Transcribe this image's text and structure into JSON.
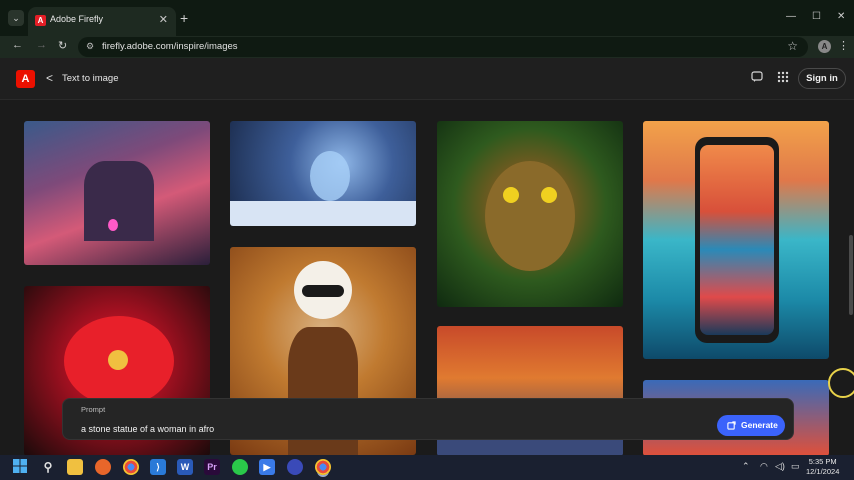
{
  "browser": {
    "tab_title": "Adobe Firefly",
    "url": "firefly.adobe.com/inspire/images",
    "tab_menu_icon": "chevron-down-icon",
    "new_tab_symbol": "+",
    "close_tab_symbol": "✕",
    "minimize_symbol": "—",
    "maximize_symbol": "☐",
    "close_window_symbol": "✕",
    "profile_initial": "A"
  },
  "header": {
    "logo_letter": "A",
    "back_symbol": "<",
    "title": "Text to image",
    "sign_in_label": "Sign in"
  },
  "gallery": {
    "images": [
      {
        "name": "castle-image",
        "subject": "fantasy castle"
      },
      {
        "name": "deer-image",
        "subject": "crystal deer"
      },
      {
        "name": "owl-image",
        "subject": "owl in jungle"
      },
      {
        "name": "phone-image",
        "subject": "phone with ocean"
      },
      {
        "name": "woman-image",
        "subject": "woman with sunglasses"
      },
      {
        "name": "orchid-image",
        "subject": "red orchid"
      },
      {
        "name": "autumn-image",
        "subject": "autumn forest"
      },
      {
        "name": "sunset-image",
        "subject": "sunset sky"
      }
    ]
  },
  "prompt": {
    "label": "Prompt",
    "value": "a stone statue of a woman in afro",
    "generate_label": "Generate"
  },
  "taskbar": {
    "time": "5:35 PM",
    "date": "12/1/2024"
  },
  "colors": {
    "accent": "#3b63fb",
    "adobe_red": "#eb1000",
    "page_bg": "#1b1b1b"
  }
}
